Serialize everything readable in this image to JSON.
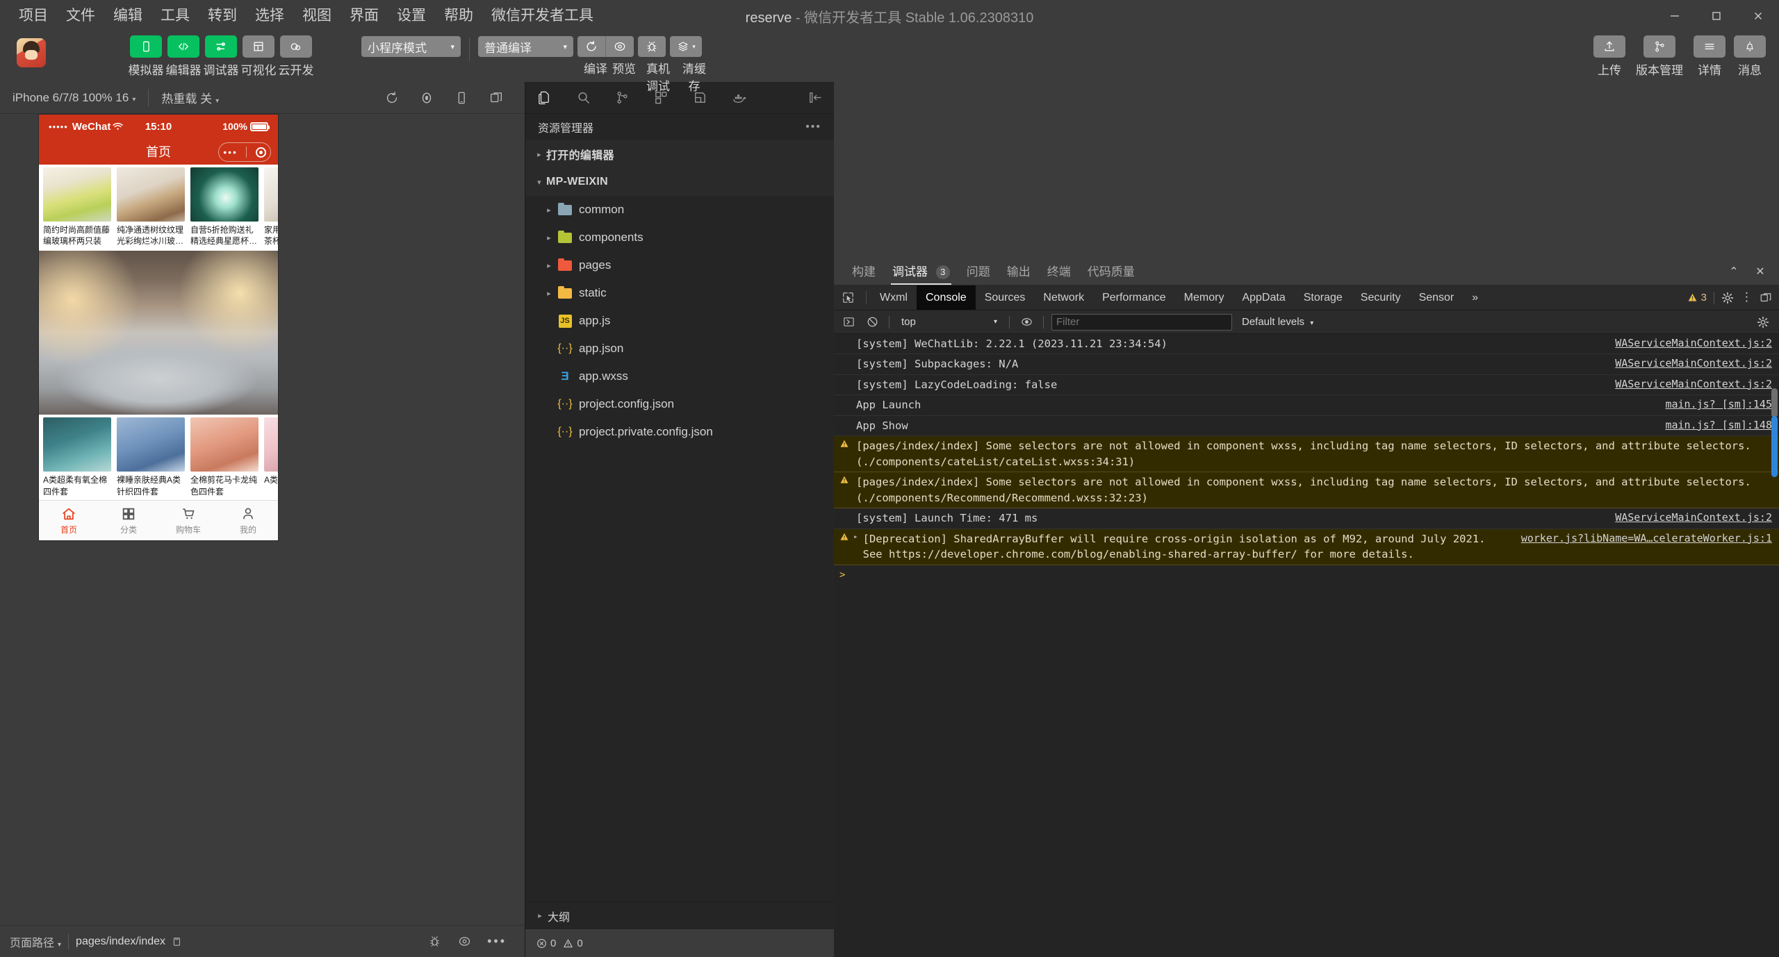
{
  "window": {
    "title_project": "reserve",
    "title_rest": " - 微信开发者工具 Stable 1.06.2308310",
    "minimize": "minimize-icon",
    "maximize": "maximize-icon",
    "close": "close-icon"
  },
  "menubar": {
    "items": [
      {
        "label": "项目"
      },
      {
        "label": "文件"
      },
      {
        "label": "编辑"
      },
      {
        "label": "工具"
      },
      {
        "label": "转到"
      },
      {
        "label": "选择"
      },
      {
        "label": "视图"
      },
      {
        "label": "界面"
      },
      {
        "label": "设置"
      },
      {
        "label": "帮助"
      },
      {
        "label": "微信开发者工具"
      }
    ]
  },
  "toolbar": {
    "left_buttons": [
      {
        "label": "模拟器",
        "icon": "phone-icon",
        "style": "green"
      },
      {
        "label": "编辑器",
        "icon": "code-icon",
        "style": "green"
      },
      {
        "label": "调试器",
        "icon": "sliders-icon",
        "style": "green"
      },
      {
        "label": "可视化",
        "icon": "layout-icon",
        "style": "grey"
      },
      {
        "label": "云开发",
        "icon": "cloud-icon",
        "style": "grey"
      }
    ],
    "mode_select": {
      "value": "小程序模式",
      "caret": "▾"
    },
    "compile_select": {
      "value": "普通编译",
      "caret": "▾"
    },
    "action_buttons": [
      {
        "label": "编译",
        "icon": "refresh-icon"
      },
      {
        "label": "预览",
        "icon": "eye-icon"
      },
      {
        "label": "真机调试",
        "icon": "bug-icon"
      },
      {
        "label": "清缓存",
        "icon": "layers-icon"
      }
    ],
    "right_buttons": [
      {
        "label": "上传",
        "icon": "upload-icon"
      },
      {
        "label": "版本管理",
        "icon": "branch-icon"
      },
      {
        "label": "详情",
        "icon": "menu-icon"
      },
      {
        "label": "消息",
        "icon": "bell-icon"
      }
    ]
  },
  "simulator": {
    "device_select": {
      "value": "iPhone 6/7/8 100% 16",
      "caret": "▾"
    },
    "hotreload_select": {
      "value": "热重载 关",
      "caret": "▾"
    },
    "tools": [
      {
        "name": "rotate-icon"
      },
      {
        "name": "record-icon"
      },
      {
        "name": "device-icon"
      },
      {
        "name": "detach-icon"
      }
    ],
    "phone": {
      "status": {
        "dots": "•••••",
        "carrier": "WeChat",
        "wifi": "wifi-icon",
        "time": "15:10",
        "battery_pct": "100%"
      },
      "nav_title": "首页",
      "capsule": {
        "menu": "•••",
        "target": "target-icon"
      },
      "top_products": [
        {
          "name": "简约时尚高颜值藤编玻璃杯两只装"
        },
        {
          "name": "纯净通透树纹纹理光彩绚烂冰川玻…"
        },
        {
          "name": "自营5折抢购送礼精选经典星愿杯…"
        },
        {
          "name": "家用加厚玻璃杯泡茶杯"
        }
      ],
      "banner_alt": "bedroom-banner",
      "bottom_products": [
        {
          "name": "A类超柔有氧全棉四件套"
        },
        {
          "name": "裸睡亲肤经典A类针织四件套"
        },
        {
          "name": "全棉剪花马卡龙纯色四件套"
        },
        {
          "name": "A类亲肤支西西里"
        }
      ],
      "tabbar": [
        {
          "label": "首页",
          "icon": "home-icon",
          "active": true
        },
        {
          "label": "分类",
          "icon": "grid-icon",
          "active": false
        },
        {
          "label": "购物车",
          "icon": "cart-icon",
          "active": false
        },
        {
          "label": "我的",
          "icon": "user-icon",
          "active": false
        }
      ]
    },
    "bottom": {
      "label": "页面路径",
      "caret": "▾",
      "path": "pages/index/index",
      "copy_icon": "copy-icon",
      "tools": [
        {
          "name": "bug-icon"
        },
        {
          "name": "eye-icon"
        },
        {
          "name": "more-icon"
        }
      ]
    }
  },
  "explorer": {
    "activity_icons": [
      {
        "name": "files-icon",
        "active": true
      },
      {
        "name": "search-icon",
        "active": false
      },
      {
        "name": "source-control-icon",
        "active": false
      },
      {
        "name": "extensions-icon",
        "active": false
      },
      {
        "name": "snippets-icon",
        "active": false
      },
      {
        "name": "docker-icon",
        "active": false
      },
      {
        "name": "collapse-panel-icon",
        "active": false
      }
    ],
    "title": "资源管理器",
    "more": "•••",
    "tree": [
      {
        "label": "打开的编辑器",
        "type": "section",
        "arrow": "▸",
        "depth": 0
      },
      {
        "label": "MP-WEIXIN",
        "type": "section",
        "arrow": "▾",
        "depth": 0
      },
      {
        "label": "common",
        "type": "folder",
        "arrow": "▸",
        "depth": 1,
        "color": "#8aa5b5"
      },
      {
        "label": "components",
        "type": "folder",
        "arrow": "▸",
        "depth": 1,
        "color": "#b5c337"
      },
      {
        "label": "pages",
        "type": "folder",
        "arrow": "▸",
        "depth": 1,
        "color": "#f0593c"
      },
      {
        "label": "static",
        "type": "folder",
        "arrow": "▸",
        "depth": 1,
        "color": "#f4b942"
      },
      {
        "label": "app.js",
        "type": "js",
        "arrow": "",
        "depth": 2
      },
      {
        "label": "app.json",
        "type": "json",
        "arrow": "",
        "depth": 2
      },
      {
        "label": "app.wxss",
        "type": "wxss",
        "arrow": "",
        "depth": 2
      },
      {
        "label": "project.config.json",
        "type": "json",
        "arrow": "",
        "depth": 2
      },
      {
        "label": "project.private.config.json",
        "type": "json",
        "arrow": "",
        "depth": 2
      }
    ],
    "outline": {
      "label": "大纲",
      "arrow": "▸"
    },
    "status": {
      "errors": "0",
      "warnings": "0",
      "error_icon": "error-circle-icon",
      "warning_icon": "warning-triangle-icon"
    }
  },
  "devtools": {
    "panel_tabs": [
      {
        "label": "构建",
        "active": false,
        "badge": null
      },
      {
        "label": "调试器",
        "active": true,
        "badge": "3"
      },
      {
        "label": "问题",
        "active": false,
        "badge": null
      },
      {
        "label": "输出",
        "active": false,
        "badge": null
      },
      {
        "label": "终端",
        "active": false,
        "badge": null
      },
      {
        "label": "代码质量",
        "active": false,
        "badge": null
      }
    ],
    "panel_window_buttons": [
      {
        "name": "collapse-icon",
        "glyph": "⌃"
      },
      {
        "name": "close-icon",
        "glyph": "✕"
      }
    ],
    "chrome_tabs": [
      {
        "label": "Wxml",
        "active": false
      },
      {
        "label": "Console",
        "active": true
      },
      {
        "label": "Sources",
        "active": false
      },
      {
        "label": "Network",
        "active": false
      },
      {
        "label": "Performance",
        "active": false
      },
      {
        "label": "Memory",
        "active": false
      },
      {
        "label": "AppData",
        "active": false
      },
      {
        "label": "Storage",
        "active": false
      },
      {
        "label": "Security",
        "active": false
      },
      {
        "label": "Sensor",
        "active": false
      }
    ],
    "chrome_overflow": "»",
    "warning_count": "3",
    "right_icons": [
      {
        "name": "gear-icon"
      },
      {
        "name": "kebab-menu-icon"
      },
      {
        "name": "dock-icon"
      }
    ],
    "filterbar": {
      "execute_icon": "execute-icon",
      "clear_icon": "clear-console-icon",
      "context": "top",
      "context_caret": "▾",
      "eye_icon": "live-expression-icon",
      "filter_placeholder": "Filter",
      "filter_value": "",
      "levels": "Default levels",
      "levels_caret": "▾",
      "settings_icon": "gear-icon"
    },
    "console_rows": [
      {
        "kind": "log",
        "text": "[system] WeChatLib: 2.22.1 (2023.11.21 23:34:54)",
        "source": "WAServiceMainContext.js:2"
      },
      {
        "kind": "log",
        "text": "[system] Subpackages: N/A",
        "source": "WAServiceMainContext.js:2"
      },
      {
        "kind": "log",
        "text": "[system] LazyCodeLoading: false",
        "source": "WAServiceMainContext.js:2"
      },
      {
        "kind": "log",
        "text": "App Launch",
        "source": "main.js? [sm]:145"
      },
      {
        "kind": "log",
        "text": "App Show",
        "source": "main.js? [sm]:148"
      },
      {
        "kind": "warn",
        "text": "[pages/index/index] Some selectors are not allowed in component wxss, including tag name selectors, ID selectors, and attribute selectors.(./components/cateList/cateList.wxss:34:31)",
        "link": "./components/cateList/cateList.wxss:34",
        "source": ""
      },
      {
        "kind": "warn",
        "text": "[pages/index/index] Some selectors are not allowed in component wxss, including tag name selectors, ID selectors, and attribute selectors.(./components/Recommend/Recommend.wxss:32:23)",
        "link": "./components/Recommend/Recommend.wxss:32",
        "source": ""
      },
      {
        "kind": "log",
        "text": "[system] Launch Time: 471 ms",
        "source": "WAServiceMainContext.js:2"
      },
      {
        "kind": "warn",
        "text": "[Deprecation] SharedArrayBuffer will require cross-origin isolation as of M92, around July 2021. See https://developer.chrome.com/blog/enabling-shared-array-buffer/ for more details.",
        "link": "https://developer.chrome.com/blog/enabling-shared-array-buffer/",
        "source": "worker.js?libName=WA…celerateWorker.js:1"
      },
      {
        "kind": "prompt",
        "text": ">",
        "source": ""
      }
    ]
  },
  "colors": {
    "accent_green": "#07c160",
    "wechat_red": "#cb3217",
    "tab_active_red": "#e8411f",
    "warning_bg": "#332b00",
    "warning_icon": "#f0c040"
  }
}
